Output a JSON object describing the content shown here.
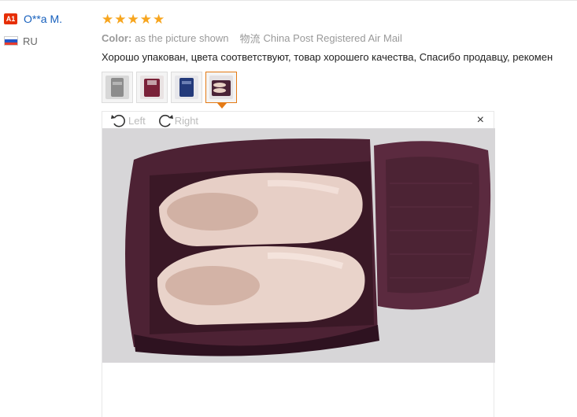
{
  "user": {
    "level_badge": "A1",
    "name": "O**a M.",
    "country_code": "RU",
    "flag_colors": [
      "#ffffff",
      "#2255c6",
      "#e63b2e"
    ]
  },
  "review": {
    "rating": 5,
    "stars": [
      "★",
      "★",
      "★",
      "★",
      "★"
    ],
    "color_label": "Color:",
    "color_value": "as the picture shown",
    "shipping_label": "物流",
    "shipping_value": "China Post Registered Air Mail",
    "text": "Хорошо упакован, цвета соответствуют, товар хорошего качества, Спасибо продавцу, рекомен"
  },
  "thumbnails": [
    {
      "name": "thumb-grey-bag",
      "color": "#8c8c8c",
      "selected": false
    },
    {
      "name": "thumb-maroon-bag",
      "color": "#7a2138",
      "selected": false
    },
    {
      "name": "thumb-navy-bag",
      "color": "#233a7a",
      "selected": false
    },
    {
      "name": "thumb-shoes-bag",
      "color": "#5a3047",
      "selected": true
    }
  ],
  "viewer": {
    "rotate_left_label": "Left",
    "rotate_right_label": "Right",
    "close_glyph": "×"
  },
  "colors": {
    "accent": "#e47a15",
    "link": "#1760bd",
    "star": "#f7a51e",
    "badge": "#e62e04"
  }
}
